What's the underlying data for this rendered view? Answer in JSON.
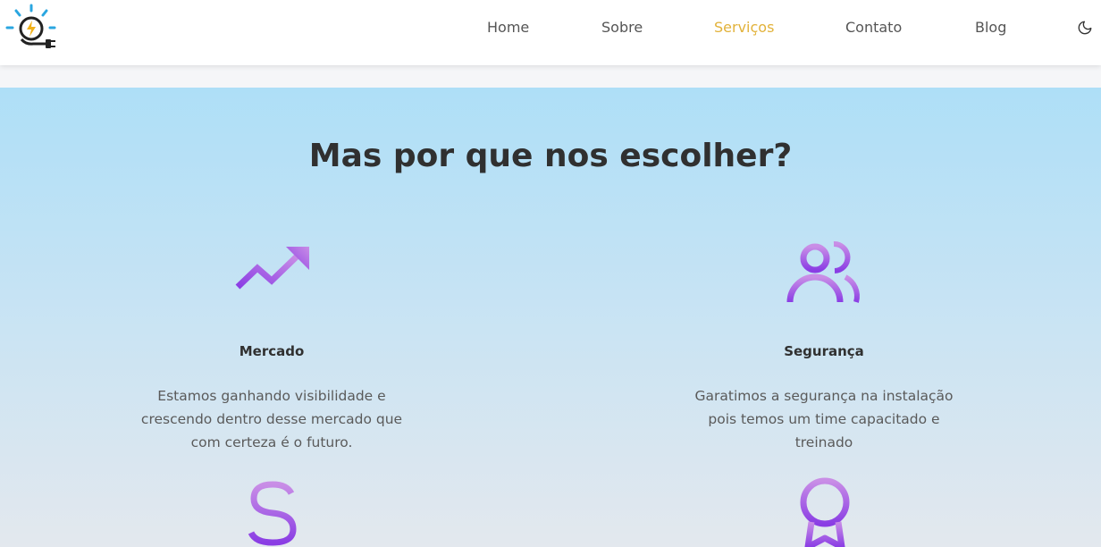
{
  "nav": {
    "items": [
      {
        "label": "Home"
      },
      {
        "label": "Sobre"
      },
      {
        "label": "Serviços"
      },
      {
        "label": "Contato"
      },
      {
        "label": "Blog"
      }
    ],
    "active_item": "Serviços",
    "active_color": "#e2b23a",
    "theme_toggle_icon": "moon-icon",
    "logo_icon": "bulb-plug-logo-icon"
  },
  "section": {
    "title": "Mas por que nos escolher?",
    "features": [
      {
        "icon": "trending-up-icon",
        "title": "Mercado",
        "text": "Estamos ganhando visibilidade e crescendo dentro desse mercado que com certeza é o futuro."
      },
      {
        "icon": "users-icon",
        "title": "Segurança",
        "text": "Garatimos a segurança na instalação pois temos um time capacitado e treinado"
      },
      {
        "icon": "dollar-icon",
        "title": "",
        "text": ""
      },
      {
        "icon": "award-icon",
        "title": "",
        "text": ""
      }
    ],
    "icon_gradient": [
      "#c98ee6",
      "#8a3de4"
    ]
  }
}
